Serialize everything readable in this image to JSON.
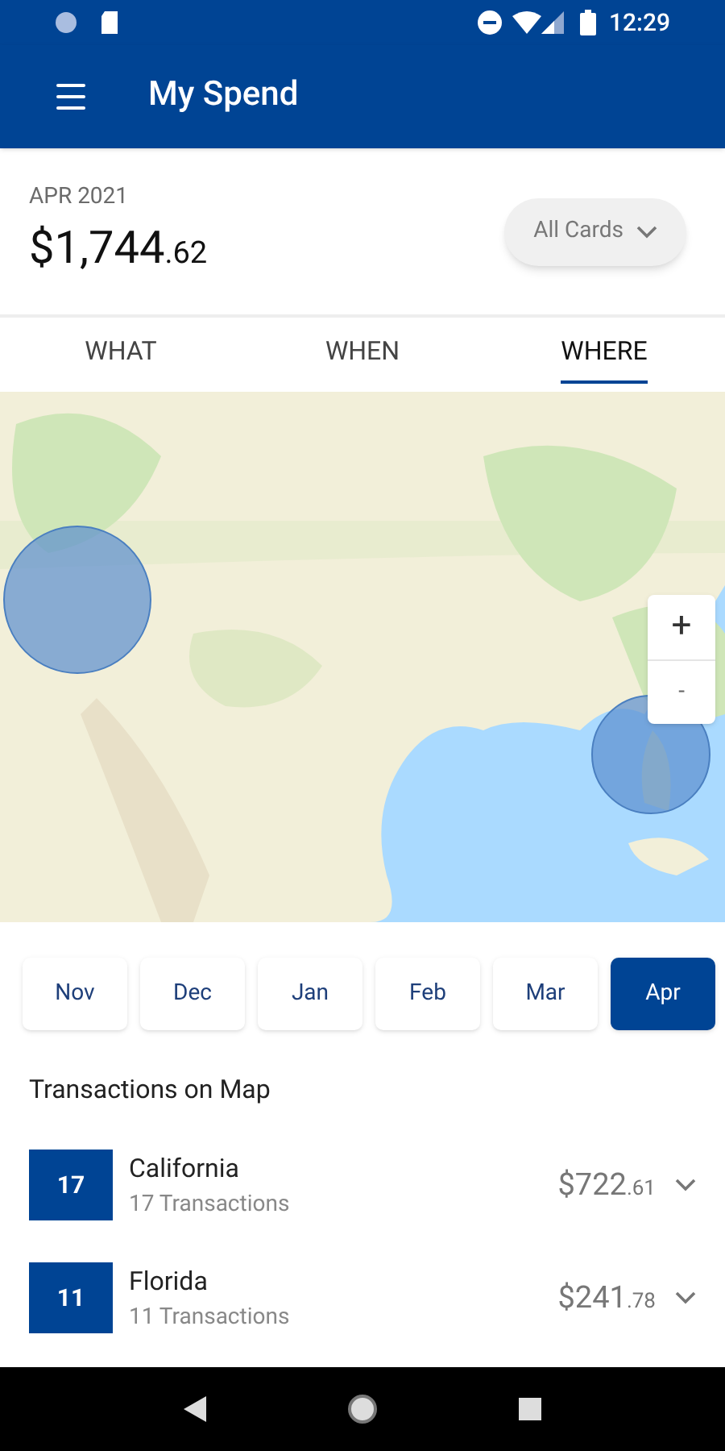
{
  "status_bar": {
    "time": "12:29"
  },
  "app_bar": {
    "title": "My Spend"
  },
  "summary": {
    "period": "APR 2021",
    "amount_main": "$1,744",
    "amount_cents": ".62",
    "filter": "All Cards"
  },
  "tabs": [
    {
      "label": "WHAT",
      "selected": false
    },
    {
      "label": "WHEN",
      "selected": false
    },
    {
      "label": "WHERE",
      "selected": true
    }
  ],
  "map": {
    "zoom_in": "+",
    "zoom_out": "-"
  },
  "months": [
    {
      "label": "Nov",
      "selected": false
    },
    {
      "label": "Dec",
      "selected": false
    },
    {
      "label": "Jan",
      "selected": false
    },
    {
      "label": "Feb",
      "selected": false
    },
    {
      "label": "Mar",
      "selected": false
    },
    {
      "label": "Apr",
      "selected": true
    }
  ],
  "list_title": "Transactions on Map",
  "locations": [
    {
      "count": "17",
      "name": "California",
      "subtitle": "17 Transactions",
      "amount_main": "$722",
      "amount_cents": ".61",
      "expanded": false
    },
    {
      "count": "11",
      "name": "Florida",
      "subtitle": "11 Transactions",
      "amount_main": "$241",
      "amount_cents": ".78",
      "expanded": false
    }
  ]
}
